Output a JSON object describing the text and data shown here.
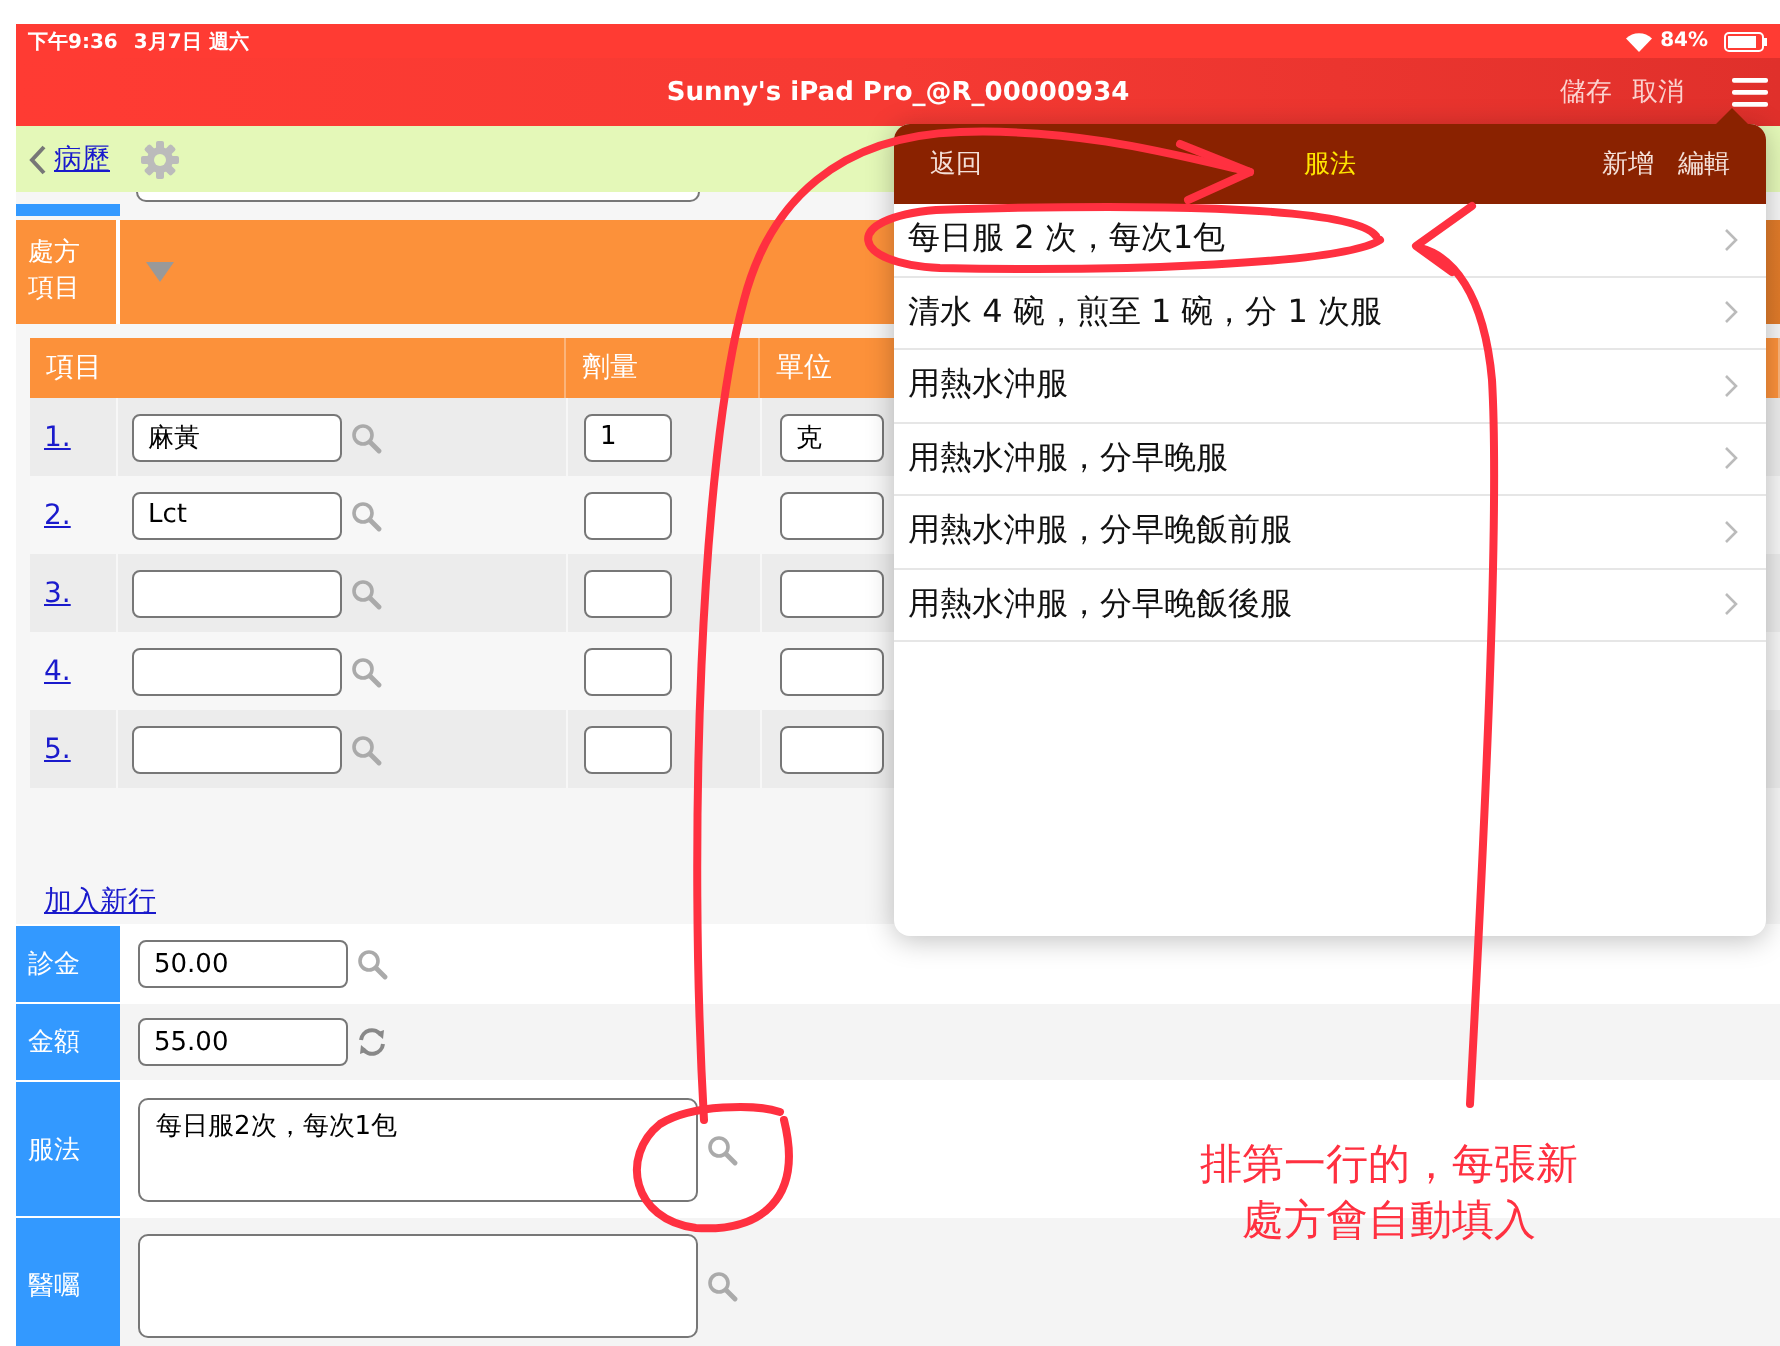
{
  "status_bar": {
    "time": "下午9:36",
    "date": "3月7日 週六",
    "battery": "84%"
  },
  "nav_bar": {
    "title": "Sunny's iPad Pro_@R_00000934",
    "actions": [
      "儲存",
      "取消"
    ]
  },
  "sub_bar": {
    "back": "病歷"
  },
  "prescription": {
    "label": [
      "處方",
      "項目"
    ]
  },
  "table": {
    "columns": [
      "項目",
      "劑量",
      "單位"
    ],
    "rows": [
      {
        "number": "1.",
        "item": "麻黃",
        "dose": "1",
        "unit": "克"
      },
      {
        "number": "2.",
        "item": "Lct"
      },
      {
        "number": "3."
      },
      {
        "number": "4."
      },
      {
        "number": "5."
      }
    ]
  },
  "add_row": "加入新行",
  "fields": [
    {
      "label": "診金",
      "kind": "input-search",
      "value": "50.00"
    },
    {
      "label": "金額",
      "kind": "input-refresh",
      "value": "55.00"
    },
    {
      "label": "服法",
      "kind": "textarea-search",
      "value": "每日服2次，每次1包"
    },
    {
      "label": "醫囑",
      "kind": "textarea-search"
    }
  ],
  "popover": {
    "back": "返回",
    "title": "服法",
    "actions": [
      "新增",
      "編輯"
    ],
    "items": [
      "每日服 2 次，每次1包",
      "清水 4 碗，煎至 1 碗，分 1 次服",
      "用熱水沖服",
      "用熱水沖服，分早晚服",
      "用熱水沖服，分早晚飯前服",
      "用熱水沖服，分早晚飯後服"
    ]
  },
  "annotation": {
    "lines": [
      "排第一行的，每張新",
      "處方會自動填入"
    ]
  }
}
